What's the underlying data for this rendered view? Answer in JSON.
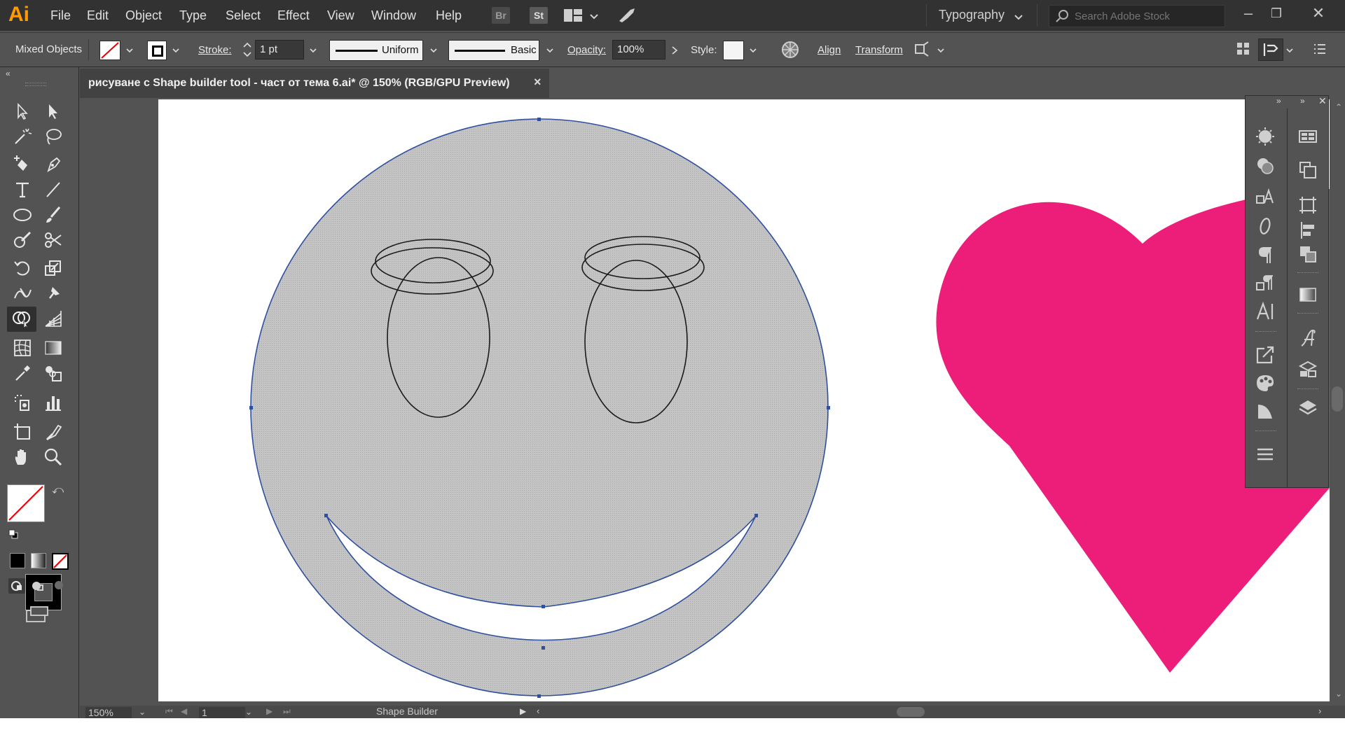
{
  "app": {
    "logo": "Ai",
    "menu": [
      "File",
      "Edit",
      "Object",
      "Type",
      "Select",
      "Effect",
      "View",
      "Window",
      "Help"
    ],
    "bridge_label": "Br",
    "stock_label": "St",
    "workspace": "Typography",
    "search_placeholder": "Search Adobe Stock"
  },
  "control_bar": {
    "selection_label": "Mixed Objects",
    "stroke_label": "Stroke:",
    "stroke_value": "1 pt",
    "profile_label": "Uniform",
    "brush_label": "Basic",
    "opacity_label": "Opacity:",
    "opacity_value": "100%",
    "style_label": "Style:",
    "align_label": "Align",
    "transform_label": "Transform"
  },
  "document": {
    "tab_title": "рисуване с Shape builder tool - част от тема 6.ai* @ 150% (RGB/GPU Preview)",
    "close_symbol": "×"
  },
  "status_bar": {
    "zoom": "150%",
    "artboard_number": "1",
    "current_tool": "Shape Builder"
  },
  "colors": {
    "heart": "#ec1e79",
    "face_fill": "#c0c0c0",
    "selection": "#2f4f9f",
    "logo": "#ff9a00"
  },
  "artwork": {
    "shapes": [
      "smiley-face",
      "left-eye",
      "right-eye",
      "left-halo",
      "right-halo",
      "smile-mouth",
      "heart"
    ]
  }
}
